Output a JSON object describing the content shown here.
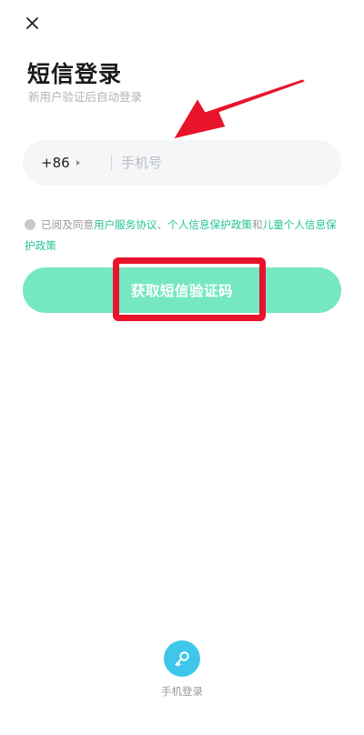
{
  "header": {
    "close_icon": "close-icon",
    "title": "短信登录",
    "subtitle": "新用户验证后自动登录"
  },
  "phone": {
    "country_code": "+86",
    "placeholder": "手机号",
    "value": ""
  },
  "agreement": {
    "checked": false,
    "prefix": "已阅及同意",
    "link_user_service": "用户服务协议",
    "sep1": "、",
    "link_privacy": "个人信息保护政策",
    "sep2": "和",
    "link_child_privacy": "儿童个人信息保护政策"
  },
  "actions": {
    "get_sms_code": "获取短信验证码"
  },
  "alt_login": {
    "label": "手机登录",
    "icon": "key-icon"
  },
  "colors": {
    "accent": "#76e7c3",
    "link": "#27c39a",
    "annotation_red": "#e8142b",
    "alt_icon_bg": "#3ec7ea"
  }
}
